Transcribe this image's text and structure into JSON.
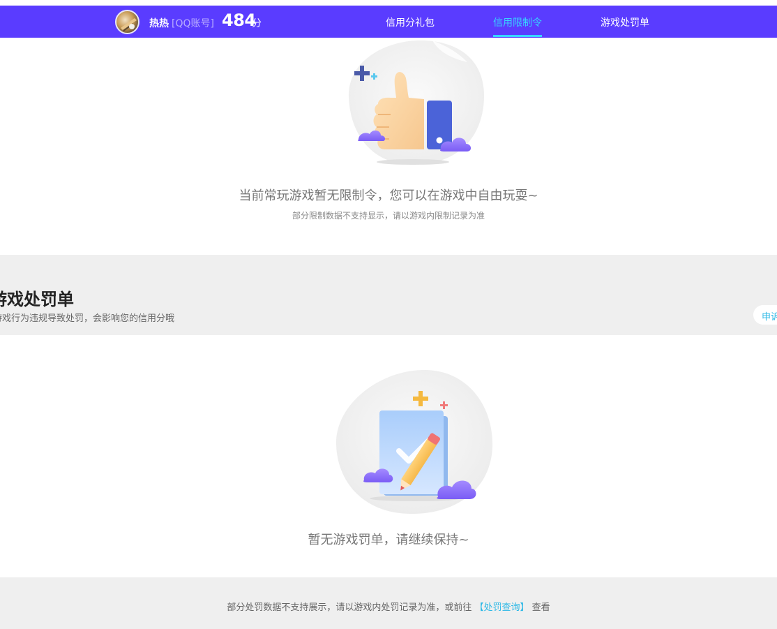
{
  "header": {
    "nickname": "热热",
    "account_type": "[QQ账号]",
    "score": "484",
    "score_unit": "分",
    "tabs": [
      {
        "label": "信用分礼包",
        "active": false
      },
      {
        "label": "信用限制令",
        "active": true
      },
      {
        "label": "游戏处罚单",
        "active": false
      }
    ]
  },
  "restriction": {
    "empty_message": "当前常玩游戏暂无限制令，您可以在游戏中自由玩耍~",
    "note": "部分限制数据不支持显示，请以游戏内限制记录为准"
  },
  "penalty_section": {
    "title": "游戏处罚单",
    "description": "游戏行为违规导致处罚，会影响您的信用分哦",
    "appeal_label": "申诉",
    "empty_message": "暂无游戏罚单，请继续保持~"
  },
  "footer": {
    "text_before": "部分处罚数据不支持展示，请以游戏内处罚记录为准，或前往",
    "link_label": "【处罚查询】",
    "text_after": "查看"
  },
  "colors": {
    "nav_bg": "#5a3cff",
    "active_tab": "#37d4ff",
    "link": "#2bb8e6",
    "section_bg": "#efefef"
  },
  "icons": {
    "restriction_illustration": "thumbs-up-illustration",
    "penalty_illustration": "checklist-pencil-illustration"
  }
}
